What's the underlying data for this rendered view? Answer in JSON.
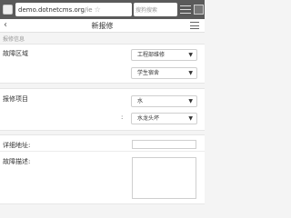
{
  "browser": {
    "url_main": "demo.dotnetcms.org",
    "url_suffix": "/ie",
    "search_placeholder": "搜狗搜索"
  },
  "header": {
    "back_icon": "‹",
    "title": "新报修",
    "menu_icon": "hamburger-icon"
  },
  "section_title": "报修信息",
  "fault_area": {
    "label": "故障区域",
    "select1": "工程部维修",
    "select2": "学生宿舍"
  },
  "repair_item": {
    "label": "报修项目",
    "select1": "水",
    "select2": "水龙头坏"
  },
  "address": {
    "label": "详细地址:"
  },
  "description": {
    "label": "故障描述:"
  }
}
